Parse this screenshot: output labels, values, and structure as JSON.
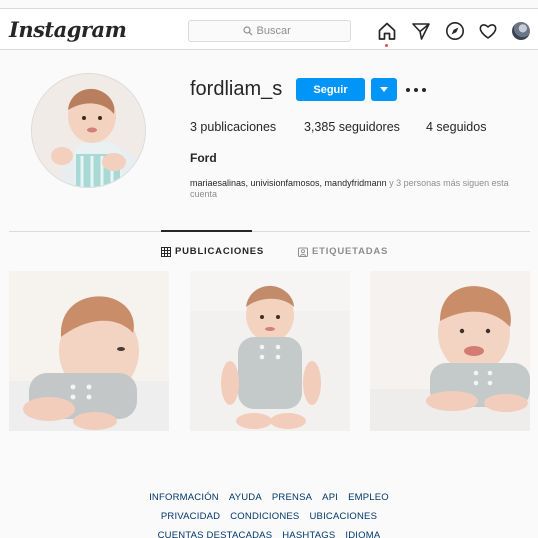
{
  "header": {
    "logo": "Instagram",
    "search_placeholder": "Buscar"
  },
  "profile": {
    "username": "fordliam_s",
    "follow_label": "Seguir",
    "stats": {
      "posts": "3 publicaciones",
      "followers": "3,385 seguidores",
      "following": "4 seguidos"
    },
    "full_name": "Ford",
    "followed_by_names": "mariaesalinas, univisionfamosos, mandyfridmann",
    "followed_by_rest": " y 3 personas más siguen esta cuenta"
  },
  "tabs": {
    "posts": "PUBLICACIONES",
    "tagged": "ETIQUETADAS"
  },
  "footer": {
    "row1": [
      "INFORMACIÓN",
      "AYUDA",
      "PRENSA",
      "API",
      "EMPLEO"
    ],
    "row2": [
      "PRIVACIDAD",
      "CONDICIONES",
      "UBICACIONES"
    ],
    "row3": [
      "CUENTAS DESTACADAS",
      "HASHTAGS",
      "IDIOMA"
    ]
  },
  "colors": {
    "accent": "#0095f6",
    "notification": "#ed4956",
    "link": "#00376b"
  }
}
